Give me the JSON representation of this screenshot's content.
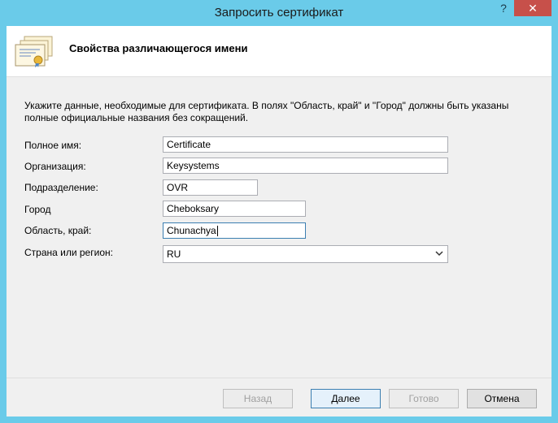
{
  "window": {
    "title": "Запросить сертификат",
    "help_glyph": "?",
    "close_glyph": "✕"
  },
  "header": {
    "title": "Свойства различающегося имени",
    "icon": "certificate-icon"
  },
  "instructions": "Укажите данные, необходимые для сертификата. В полях \"Область, край\" и \"Город\" должны быть указаны полные официальные названия без сокращений.",
  "fields": {
    "full_name": {
      "label": "Полное имя:",
      "value": "Certificate"
    },
    "organization": {
      "label": "Организация:",
      "value": "Keysystems"
    },
    "department": {
      "label": "Подразделение:",
      "value": "OVR"
    },
    "city": {
      "label": "Город",
      "value": "Cheboksary"
    },
    "region": {
      "label": "Область, край:",
      "value": "Chunachya"
    },
    "country": {
      "label": "Страна или регион:",
      "value": "RU"
    }
  },
  "buttons": {
    "back": "Назад",
    "next": "Далее",
    "finish": "Готово",
    "cancel": "Отмена"
  },
  "colors": {
    "frame": "#6acbe9",
    "close": "#c7504a",
    "focus": "#3c7fb1"
  }
}
